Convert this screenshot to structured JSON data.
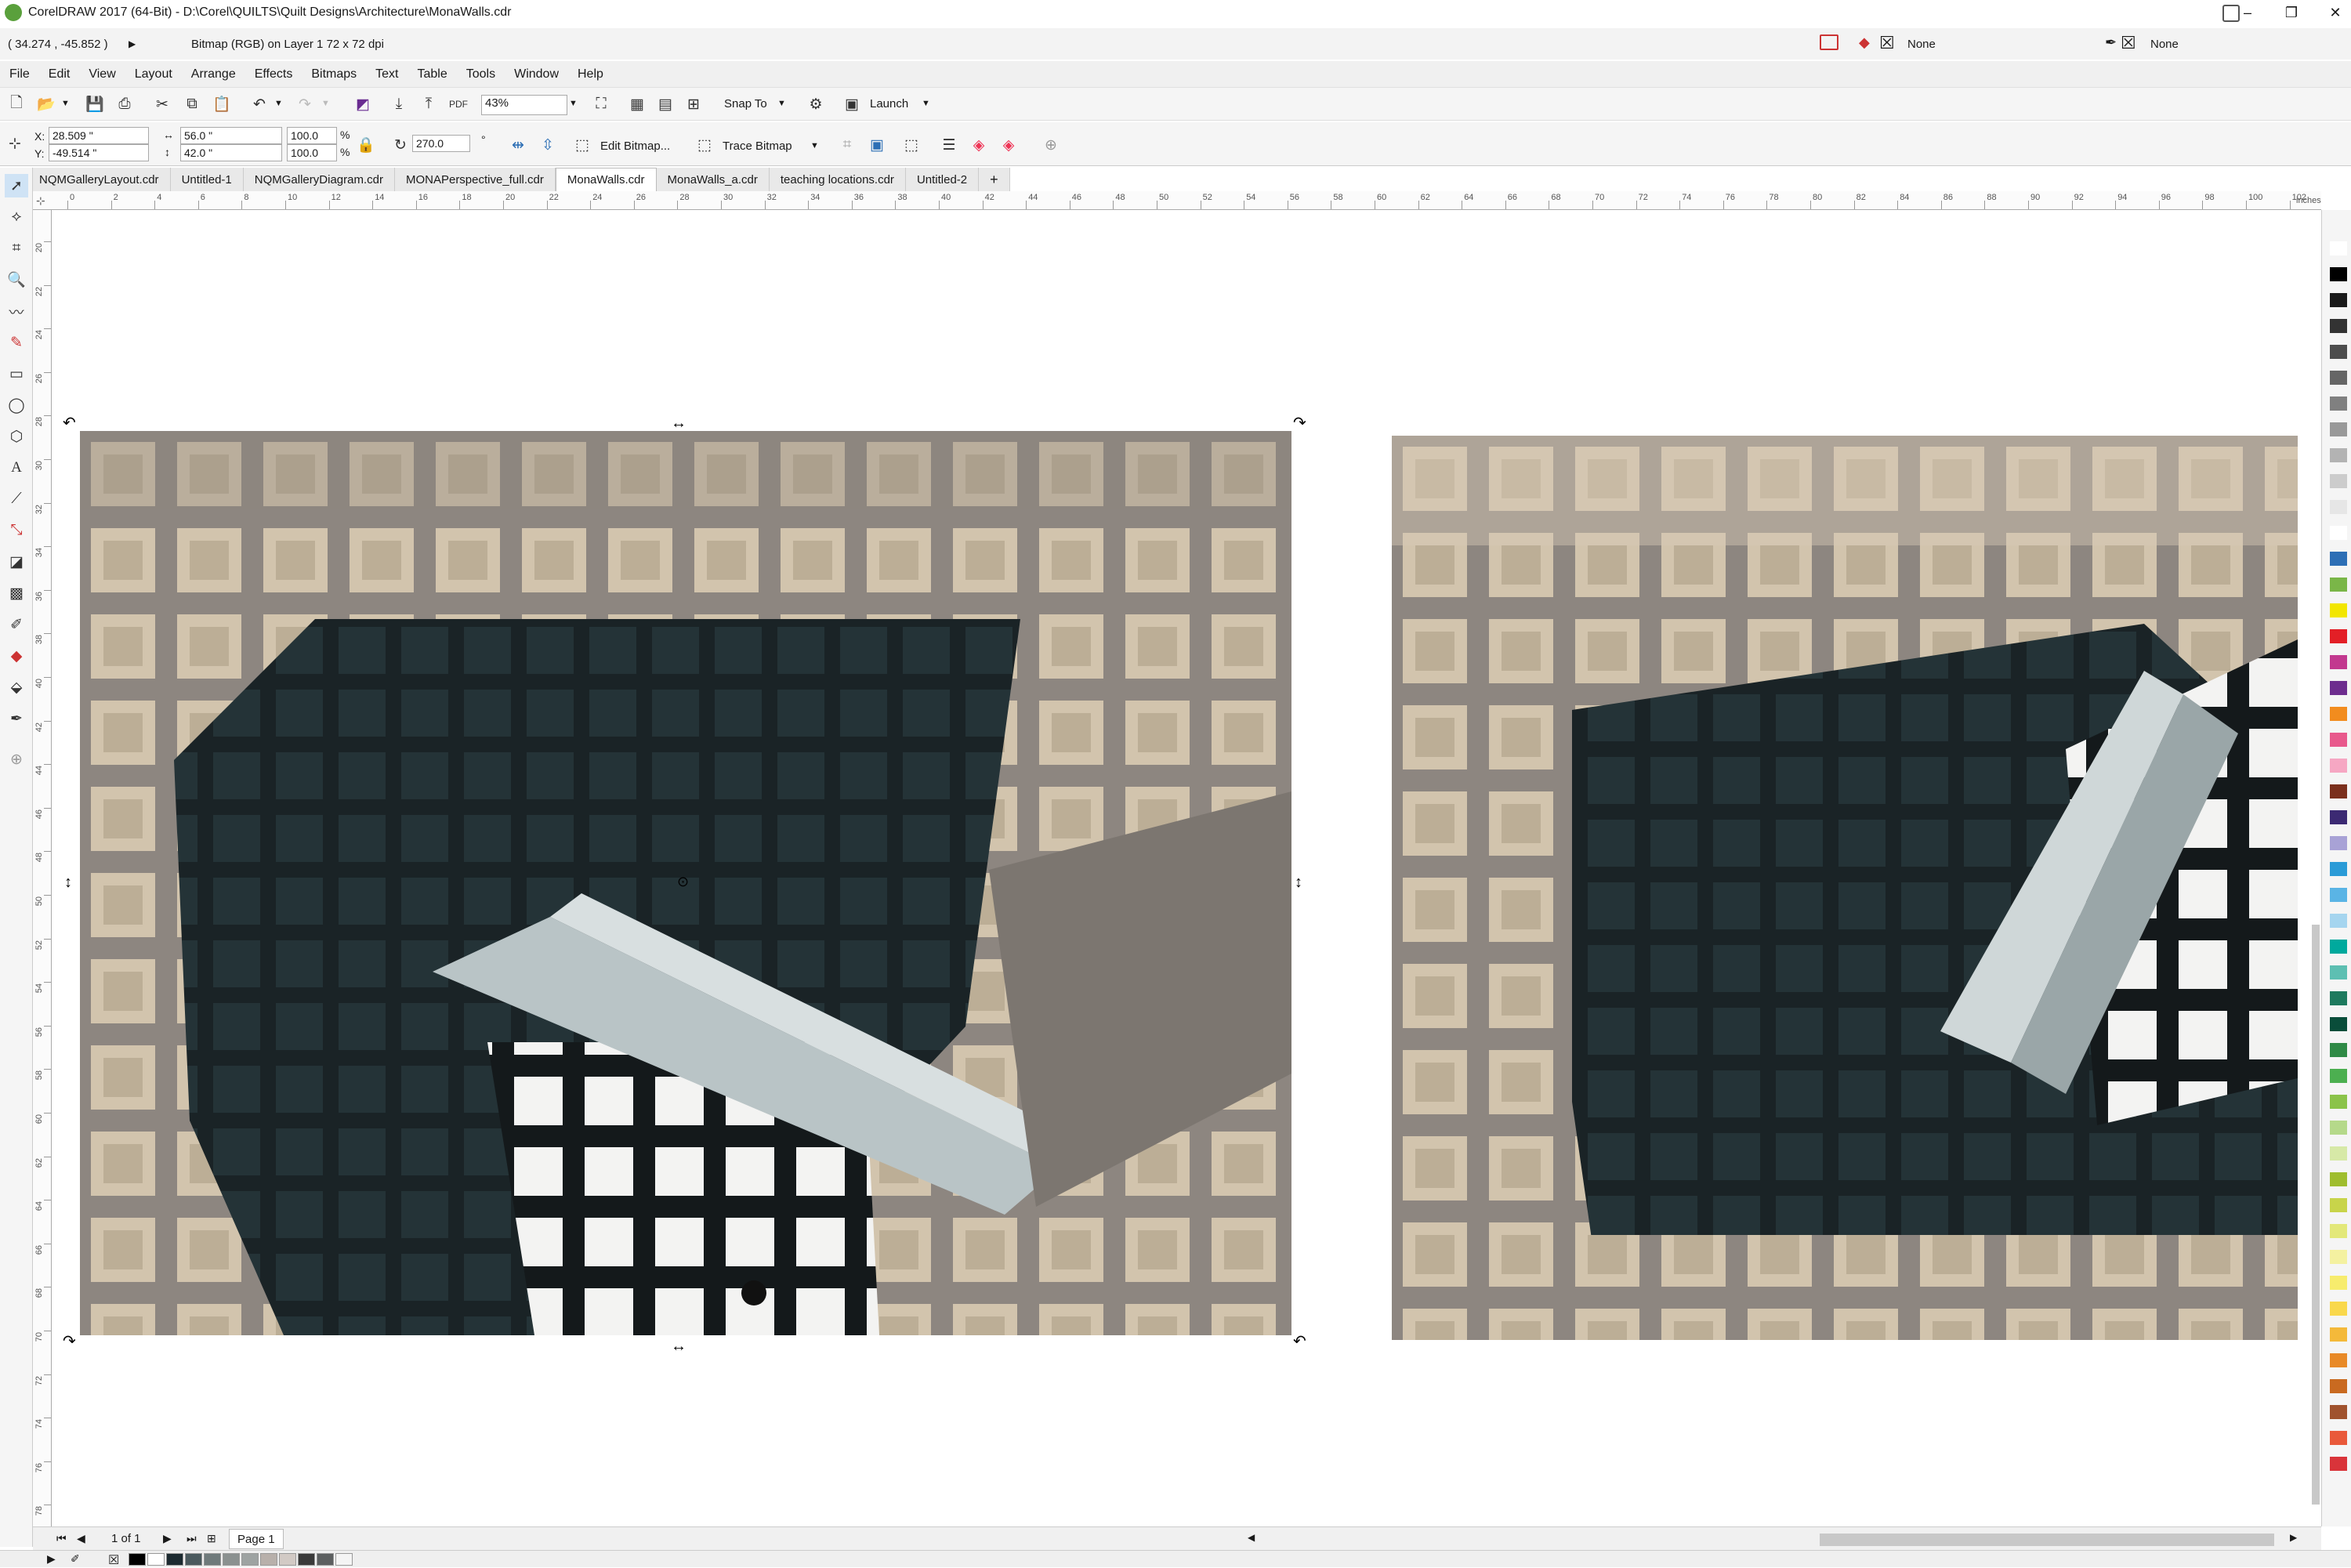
{
  "titlebar": {
    "title": "CorelDRAW 2017 (64-Bit) - D:\\Corel\\QUILTS\\Quilt Designs\\Architecture\\MonaWalls.cdr",
    "minimize": "–",
    "restore": "❐",
    "close": "✕"
  },
  "statusrow": {
    "cursor_coords": "( 34.274 , -45.852 )",
    "object_info": "Bitmap (RGB) on Layer 1 72 x 72 dpi",
    "fill_label": "None",
    "outline_label": "None"
  },
  "menu": [
    "File",
    "Edit",
    "View",
    "Layout",
    "Arrange",
    "Effects",
    "Bitmaps",
    "Text",
    "Table",
    "Tools",
    "Window",
    "Help"
  ],
  "stdbar": {
    "zoom": "43%",
    "snap_to": "Snap To",
    "launch": "Launch"
  },
  "propbar": {
    "x_label": "X:",
    "x_value": "28.509 \"",
    "y_label": "Y:",
    "y_value": "-49.514 \"",
    "w_value": "56.0 \"",
    "h_value": "42.0 \"",
    "scale_w": "100.0",
    "scale_h": "100.0",
    "pct": "%",
    "rotation": "270.0",
    "degree": "°",
    "edit_bitmap": "Edit Bitmap...",
    "trace_bitmap": "Trace Bitmap"
  },
  "doc_tabs": [
    {
      "label": "NQMGalleryLayout.cdr",
      "active": false
    },
    {
      "label": "Untitled-1",
      "active": false
    },
    {
      "label": "NQMGalleryDiagram.cdr",
      "active": false
    },
    {
      "label": "MONAPerspective_full.cdr",
      "active": false
    },
    {
      "label": "MonaWalls.cdr",
      "active": true
    },
    {
      "label": "MonaWalls_a.cdr",
      "active": false
    },
    {
      "label": "teaching locations.cdr",
      "active": false
    },
    {
      "label": "Untitled-2",
      "active": false
    }
  ],
  "ruler": {
    "h_labels": [
      "0",
      "2",
      "4",
      "6",
      "8",
      "10",
      "12",
      "14",
      "16",
      "18",
      "20",
      "22",
      "24",
      "26",
      "28",
      "30",
      "32",
      "34",
      "36",
      "38",
      "40",
      "42",
      "44",
      "46",
      "48",
      "50",
      "52",
      "54",
      "56",
      "58",
      "60",
      "62",
      "64",
      "66",
      "68",
      "70",
      "72",
      "74",
      "76",
      "78",
      "80",
      "82",
      "84",
      "86",
      "88",
      "90",
      "92",
      "94",
      "96",
      "98",
      "100",
      "102"
    ],
    "unit": "inches",
    "v_labels": [
      "20",
      "22",
      "24",
      "26",
      "28",
      "30",
      "32",
      "34",
      "36",
      "38",
      "40",
      "42",
      "44",
      "46",
      "48",
      "50",
      "52",
      "54",
      "56",
      "58",
      "60",
      "62",
      "64",
      "66",
      "68",
      "70",
      "72",
      "74",
      "76",
      "78"
    ]
  },
  "pagenav": {
    "page_count": "1 of 1",
    "page_tab": "Page 1"
  },
  "colors": {
    "palette": [
      "#ffffff",
      "#000000",
      "#1a1a1a",
      "#333333",
      "#4d4d4d",
      "#666666",
      "#808080",
      "#999999",
      "#b3b3b3",
      "#cccccc",
      "#e6e6e6",
      "#ffffff",
      "#2d6fb5",
      "#7ab648",
      "#f2e600",
      "#e31f26",
      "#c2388f",
      "#6d2c8e",
      "#f28c1e",
      "#e8598c",
      "#f6a7c3",
      "#7b2f1c",
      "#3c2a73",
      "#a8a2d6",
      "#2b9bd7",
      "#5ab4e5",
      "#a5d5ef",
      "#00a99d",
      "#5dbfb2",
      "#1e7a5e",
      "#0a4d3a",
      "#2f8a46",
      "#4caf50",
      "#8bc34a",
      "#b5d98a",
      "#d7e9a7",
      "#9fbd2e",
      "#c8d44a",
      "#e3e87a",
      "#f4f1a0",
      "#f7ec6d",
      "#f9d84c",
      "#f4b93a",
      "#e88a27",
      "#c96a20",
      "#a0522d",
      "#e9593a",
      "#d9343a"
    ],
    "bottom_swatches": [
      "#000000",
      "#ffffff",
      "#1c2a30",
      "#4b5a5e",
      "#6f7a7b",
      "#8b9190",
      "#9ea3a2",
      "#b8b0ab",
      "#d2cac5",
      "#3a3a3a",
      "#5c5f60",
      "#f4f4f4"
    ]
  },
  "icons": {
    "titlebar": "coreldraw-logo-icon",
    "toolbox": [
      "pick-tool-icon",
      "shape-tool-icon",
      "crop-tool-icon",
      "zoom-tool-icon",
      "freehand-tool-icon",
      "artistic-media-icon",
      "rectangle-tool-icon",
      "ellipse-tool-icon",
      "polygon-tool-icon",
      "text-tool-icon",
      "parallel-dimension-icon",
      "connector-tool-icon",
      "drop-shadow-icon",
      "transparency-icon",
      "eyedropper-icon",
      "interactive-fill-icon",
      "smart-fill-icon",
      "outline-pen-icon",
      "add-tool-icon"
    ]
  }
}
